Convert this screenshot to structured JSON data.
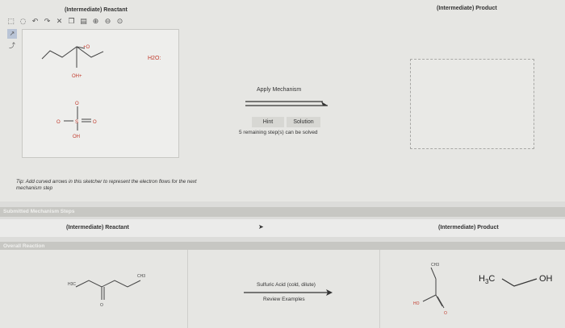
{
  "top": {
    "reactant_title": "(Intermediate) Reactant",
    "product_title": "(Intermediate) Product",
    "toolbar_icons": [
      "select-icon",
      "lasso-icon",
      "undo-icon",
      "redo-icon",
      "delete-icon",
      "copy-icon",
      "paste-icon",
      "zoom-in-icon",
      "zoom-out-icon",
      "zoom-fit-icon"
    ],
    "left_tools": [
      "arrow-tool-icon",
      "curved-arrow-icon"
    ],
    "labels": {
      "oh_plus": "OH+",
      "o_plus": "+O",
      "h2o": "H2O:",
      "o_neg": "O",
      "o_eq": "O",
      "s": "S",
      "oh": "OH",
      "o_top": "O"
    },
    "apply_mechanism": "Apply Mechanism",
    "hint": "Hint",
    "solution": "Solution",
    "remaining": "5 remaining step(s) can be solved",
    "tip": "Tip: Add curved arrows in this sketcher to represent the electron flows for the next mechanism step"
  },
  "submitted": {
    "bar_title": "Submitted Mechanism Steps",
    "reactant_title": "(Intermediate) Reactant",
    "product_title": "(Intermediate) Product"
  },
  "overall": {
    "bar_title": "Overall Reaction",
    "reagent": "Sulfuric Acid (cold, dilute)",
    "review": "Review Examples",
    "product1_ch3": "CH3",
    "product1_ho": "HO",
    "product1_o": "O",
    "reactant_h3c": "H3C",
    "reactant_ch3": "CH3",
    "reactant_o": "O",
    "h3c_sub": "3",
    "h3c_pre": "H",
    "h3c_post": "C",
    "oh": "OH"
  },
  "colors": {
    "accent_red": "#c0392b",
    "ink": "#333333"
  }
}
